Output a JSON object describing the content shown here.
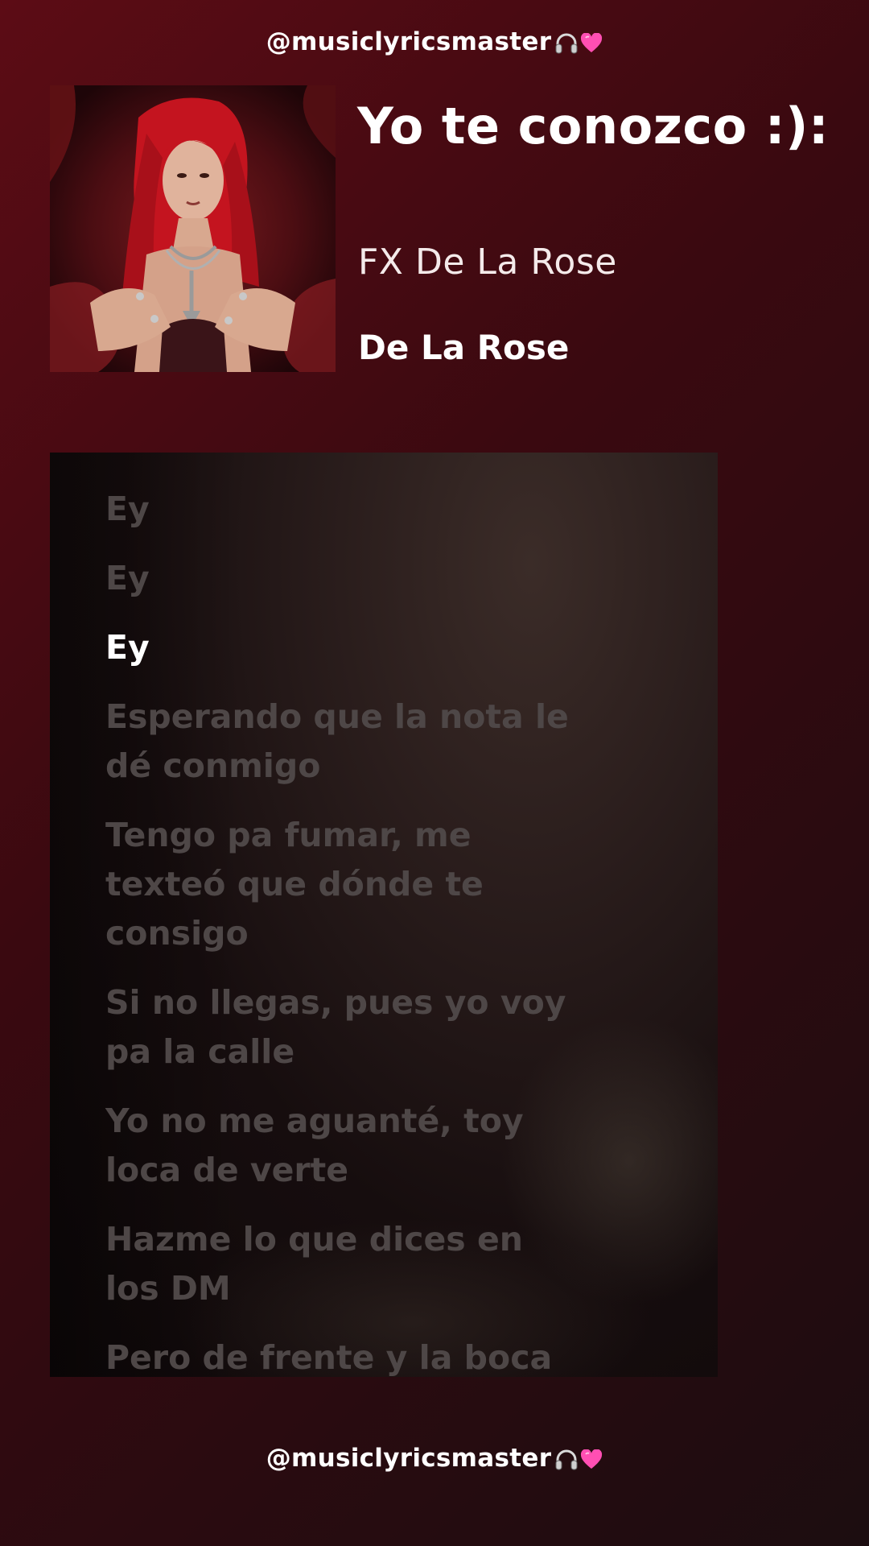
{
  "handle": {
    "text": "@musiclyricsmaster",
    "icon": "headphones-icon",
    "heart_icon": "pink-heart-icon",
    "heart_color": "#ff4fb3"
  },
  "song": {
    "title": "Yo te conozco :):",
    "artist": "FX De La Rose",
    "album": "De La Rose"
  },
  "lyrics": [
    {
      "text": "Ey",
      "active": false
    },
    {
      "text": "Ey",
      "active": false
    },
    {
      "text": "Ey",
      "active": true
    },
    {
      "text": "Esperando que la nota le dé conmigo",
      "active": false
    },
    {
      "text": "Tengo pa fumar, me texteó que dónde te consigo",
      "active": false
    },
    {
      "text": "Si no llegas, pues yo voy pa la calle",
      "active": false
    },
    {
      "text": "Yo no me aguanté, toy loca de verte",
      "active": false
    },
    {
      "text": "Hazme lo que dices en los DM",
      "active": false
    },
    {
      "text": "Pero de frente y la boca",
      "active": false
    }
  ],
  "colors": {
    "background_top": "#5c0c15",
    "background_bottom": "#1c0d10",
    "lyric_inactive": "#4e4747",
    "lyric_active": "#ffffff"
  }
}
